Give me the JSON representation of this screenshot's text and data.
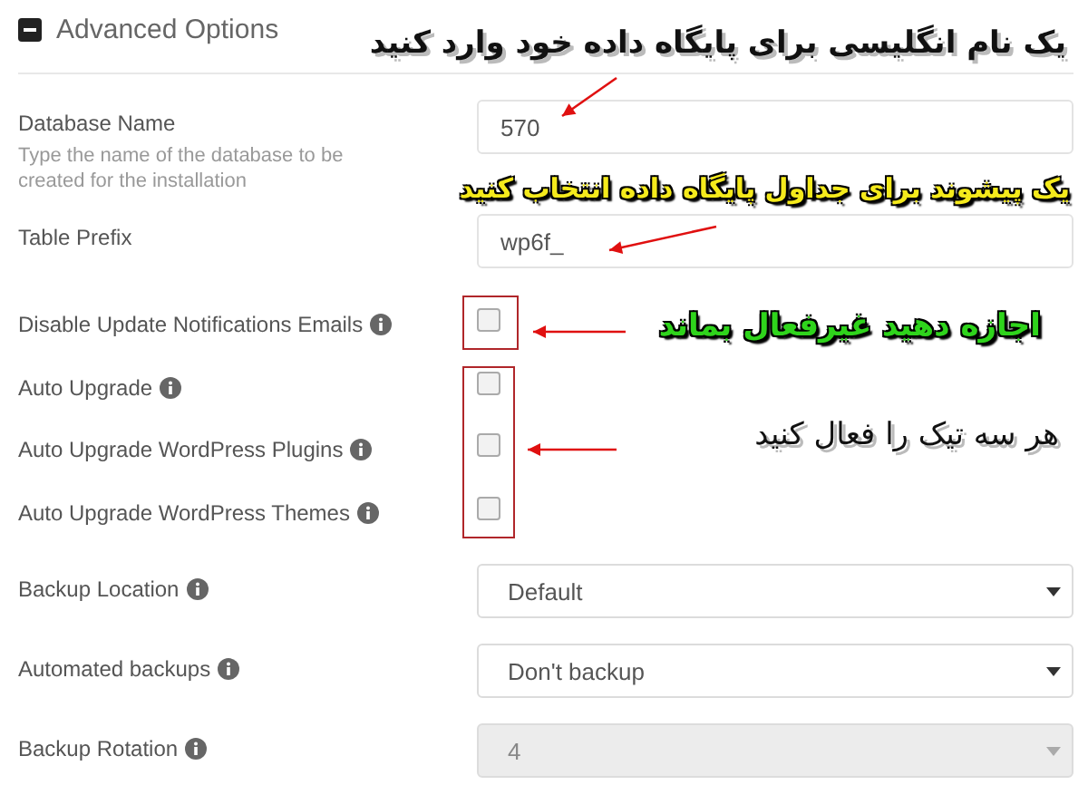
{
  "section": {
    "title": "Advanced Options",
    "expanded": true
  },
  "fields": [
    {
      "kind": "text",
      "label": "Database Name",
      "help": "Type the name of the database to be created for the installation",
      "info": false,
      "value": "570"
    },
    {
      "kind": "text",
      "label": "Table Prefix",
      "info": false,
      "value": "wp6f_"
    },
    {
      "kind": "checkbox",
      "label": "Disable Update Notifications Emails",
      "info": true,
      "checked": false
    },
    {
      "kind": "checkbox",
      "label": "Auto Upgrade",
      "info": true,
      "checked": false
    },
    {
      "kind": "checkbox",
      "label": "Auto Upgrade WordPress Plugins",
      "info": true,
      "checked": false
    },
    {
      "kind": "checkbox",
      "label": "Auto Upgrade WordPress Themes",
      "info": true,
      "checked": false
    },
    {
      "kind": "select",
      "label": "Backup Location",
      "info": true,
      "value": "Default",
      "disabled": false
    },
    {
      "kind": "select",
      "label": "Automated backups",
      "info": true,
      "value": "Don't backup",
      "disabled": false
    },
    {
      "kind": "select",
      "label": "Backup Rotation",
      "info": true,
      "value": "4",
      "disabled": true
    }
  ],
  "annotations": [
    {
      "text": "یک نام انگلیسی برای پایگاه داده خود وارد کنید",
      "color": "#111111"
    },
    {
      "text": "یک پیشوند برای جداول پایگاه داده انتخاب کنید",
      "color": "#f5ea1c"
    },
    {
      "text": "اجازه دهید غیرفعال بماند",
      "color": "#2fd41c"
    },
    {
      "text": "هر سه تیک را فعال کنید",
      "color": "#111111"
    }
  ]
}
